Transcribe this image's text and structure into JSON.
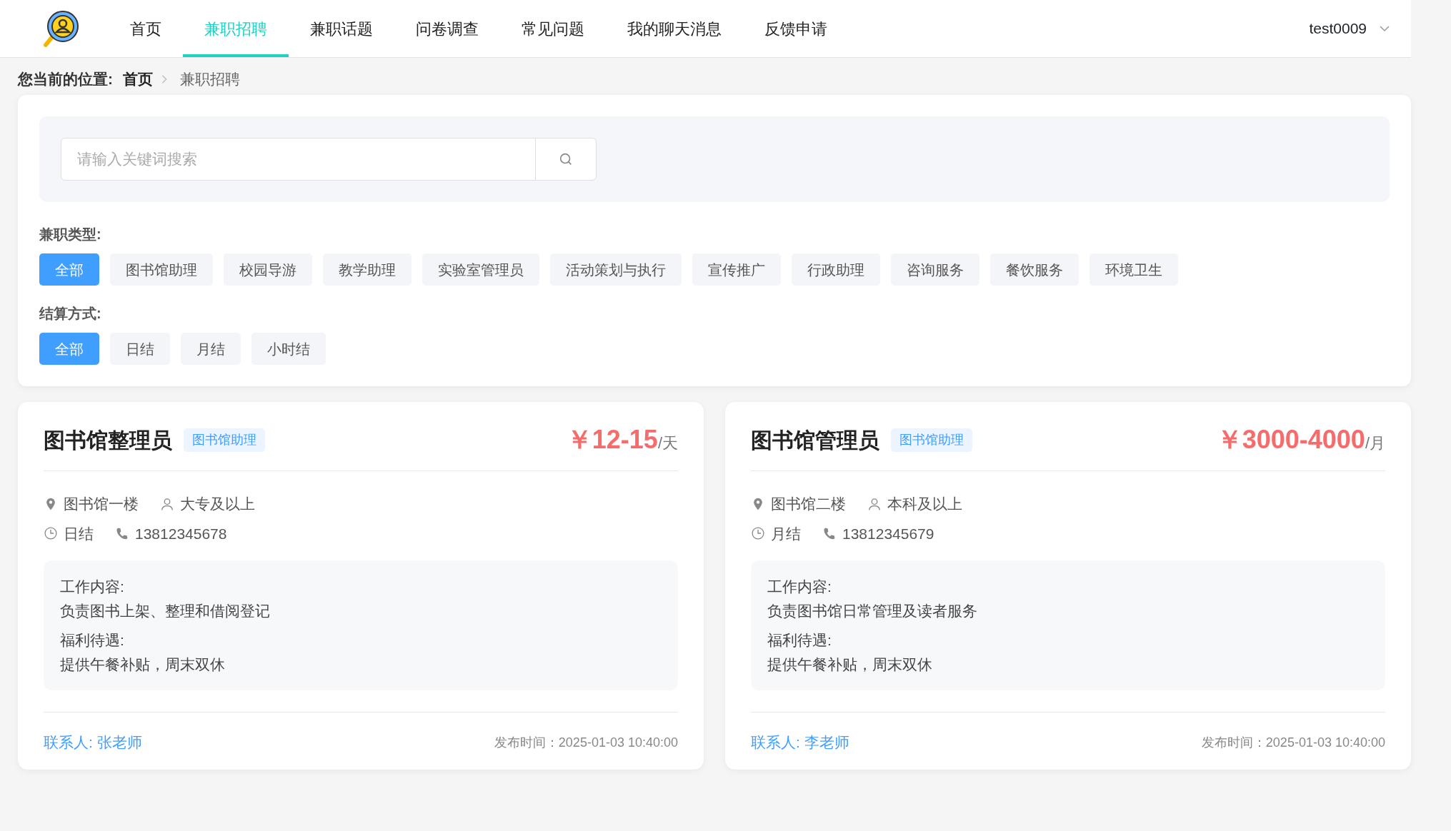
{
  "nav": {
    "items": [
      {
        "label": "首页",
        "selected": false
      },
      {
        "label": "兼职招聘",
        "selected": true
      },
      {
        "label": "兼职话题",
        "selected": false
      },
      {
        "label": "问卷调查",
        "selected": false
      },
      {
        "label": "常见问题",
        "selected": false
      },
      {
        "label": "我的聊天消息",
        "selected": false
      },
      {
        "label": "反馈申请",
        "selected": false
      }
    ],
    "user": "test0009"
  },
  "breadcrumb": {
    "label": "您当前的位置:",
    "items": [
      "首页",
      "兼职招聘"
    ]
  },
  "search": {
    "placeholder": "请输入关键词搜索"
  },
  "filters": [
    {
      "label": "兼职类型:",
      "options": [
        {
          "label": "全部",
          "selected": true
        },
        {
          "label": "图书馆助理",
          "selected": false
        },
        {
          "label": "校园导游",
          "selected": false
        },
        {
          "label": "教学助理",
          "selected": false
        },
        {
          "label": "实验室管理员",
          "selected": false
        },
        {
          "label": "活动策划与执行",
          "selected": false
        },
        {
          "label": "宣传推广",
          "selected": false
        },
        {
          "label": "行政助理",
          "selected": false
        },
        {
          "label": "咨询服务",
          "selected": false
        },
        {
          "label": "餐饮服务",
          "selected": false
        },
        {
          "label": "环境卫生",
          "selected": false
        }
      ]
    },
    {
      "label": "结算方式:",
      "options": [
        {
          "label": "全部",
          "selected": true
        },
        {
          "label": "日结",
          "selected": false
        },
        {
          "label": "月结",
          "selected": false
        },
        {
          "label": "小时结",
          "selected": false
        }
      ]
    }
  ],
  "jobs": [
    {
      "title": "图书馆整理员",
      "tag": "图书馆助理",
      "price": "￥12-15",
      "unit": "/天",
      "location": "图书馆一楼",
      "education": "大专及以上",
      "settlement": "日结",
      "phone": "13812345678",
      "content_label": "工作内容:",
      "content": "负责图书上架、整理和借阅登记",
      "benefits_label": "福利待遇:",
      "benefits": "提供午餐补贴，周末双休",
      "contact": "联系人: 张老师",
      "published": "发布时间：2025-01-03 10:40:00"
    },
    {
      "title": "图书馆管理员",
      "tag": "图书馆助理",
      "price": "￥3000-4000",
      "unit": "/月",
      "location": "图书馆二楼",
      "education": "本科及以上",
      "settlement": "月结",
      "phone": "13812345679",
      "content_label": "工作内容:",
      "content": "负责图书馆日常管理及读者服务",
      "benefits_label": "福利待遇:",
      "benefits": "提供午餐补贴，周末双休",
      "contact": "联系人: 李老师",
      "published": "发布时间：2025-01-03 10:40:00"
    }
  ]
}
